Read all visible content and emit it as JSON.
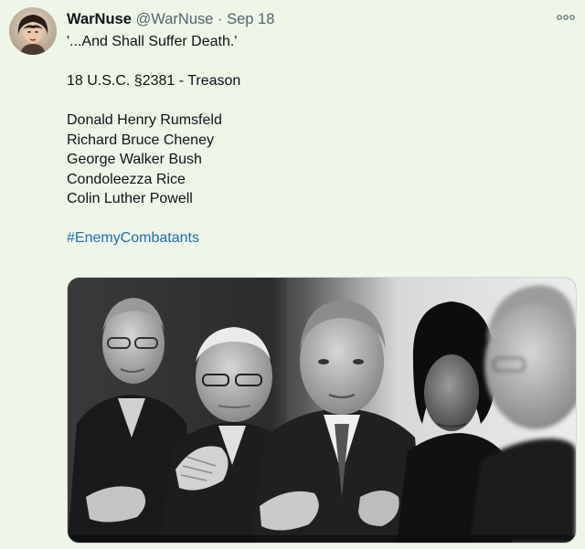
{
  "tweet": {
    "author": {
      "display_name": "WarNuse",
      "handle": "@WarNuse",
      "separator": "·",
      "date": "Sep 18"
    },
    "more_icon": "more-horizontal-icon",
    "lines": {
      "quote": "'...And Shall Suffer Death.'",
      "statute": "18 U.S.C. §2381 - Treason",
      "name1": "Donald Henry Rumsfeld",
      "name2": "Richard Bruce Cheney",
      "name3": "George Walker Bush",
      "name4": "Condoleezza Rice",
      "name5": "Colin Luther Powell"
    },
    "hashtag": "#EnemyCombatants",
    "colors": {
      "background": "#eef6e8",
      "hashtag": "#1d6fb8",
      "secondary_text": "#536471"
    }
  }
}
